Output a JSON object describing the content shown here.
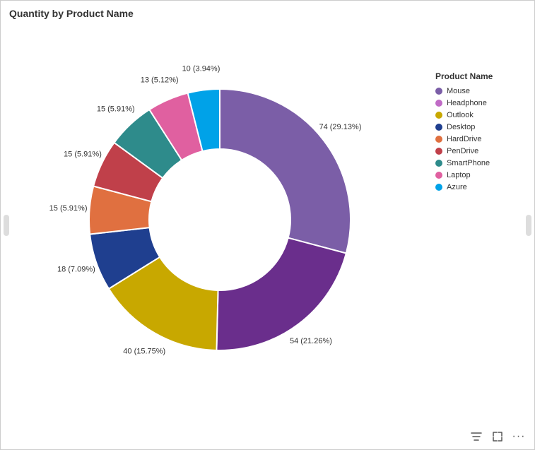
{
  "title": "Quantity by Product Name",
  "legend": {
    "title": "Product Name",
    "items": [
      {
        "label": "Mouse",
        "color": "#7B5EA7"
      },
      {
        "label": "Headphone",
        "color": "#C06BC6"
      },
      {
        "label": "Outlook",
        "color": "#C8A800"
      },
      {
        "label": "Desktop",
        "color": "#1F3F8F"
      },
      {
        "label": "HardDrive",
        "color": "#E07040"
      },
      {
        "label": "PenDrive",
        "color": "#C0404A"
      },
      {
        "label": "SmartPhone",
        "color": "#2E8B8B"
      },
      {
        "label": "Laptop",
        "color": "#E060A0"
      },
      {
        "label": "Azure",
        "color": "#00A2E8"
      }
    ]
  },
  "segments": [
    {
      "label": "Mouse",
      "value": 74,
      "pct": 29.13,
      "color": "#7B5EA7"
    },
    {
      "label": "Headphone",
      "value": 54,
      "pct": 21.26,
      "color": "#6A2E8C"
    },
    {
      "label": "Outlook",
      "value": 40,
      "pct": 15.75,
      "color": "#C8A800"
    },
    {
      "label": "Desktop",
      "value": 18,
      "pct": 7.09,
      "color": "#1F3F8F"
    },
    {
      "label": "HardDrive",
      "value": 15,
      "pct": 5.91,
      "color": "#E07040"
    },
    {
      "label": "PenDrive",
      "value": 15,
      "pct": 5.91,
      "color": "#C0404A"
    },
    {
      "label": "SmartPhone",
      "value": 15,
      "pct": 5.91,
      "color": "#2E8B8B"
    },
    {
      "label": "Laptop",
      "value": 13,
      "pct": 5.12,
      "color": "#E060A0"
    },
    {
      "label": "Azure",
      "value": 10,
      "pct": 3.94,
      "color": "#00A2E8"
    }
  ],
  "toolbar": {
    "filter_icon": "⊽",
    "expand_icon": "⤢",
    "more_icon": "···"
  }
}
